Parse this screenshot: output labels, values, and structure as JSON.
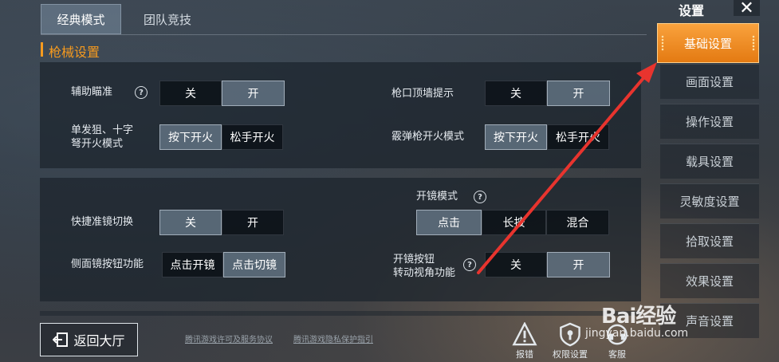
{
  "tabs": [
    {
      "label": "经典模式",
      "active": true
    },
    {
      "label": "团队竞技",
      "active": false
    }
  ],
  "section_title": "枪械设置",
  "panel1": {
    "aim_assist": {
      "label": "辅助瞄准",
      "options": [
        "关",
        "开"
      ],
      "selected": "开"
    },
    "muzzle_hint": {
      "label": "枪口顶墙提示",
      "options": [
        "关",
        "开"
      ],
      "selected": "开"
    },
    "single_fire": {
      "label_line1": "单发狙、十字",
      "label_line2": "弩开火模式",
      "options": [
        "按下开火",
        "松手开火"
      ],
      "selected": "按下开火"
    },
    "shotgun_fire": {
      "label": "霰弹枪开火模式",
      "options": [
        "按下开火",
        "松手开火"
      ],
      "selected": "按下开火"
    }
  },
  "panel2": {
    "quick_scope": {
      "label": "快捷准镜切换",
      "options": [
        "关",
        "开"
      ],
      "selected": "关"
    },
    "scope_mode": {
      "label": "开镜模式",
      "options": [
        "点击",
        "长按",
        "混合"
      ],
      "selected": "点击"
    },
    "side_scope": {
      "label": "侧面镜按钮功能",
      "options": [
        "点击开镜",
        "点击切镜"
      ],
      "selected": "点击切镜"
    },
    "scope_rotate": {
      "label_line1": "开镜按钮",
      "label_line2": "转动视角功能",
      "options": [
        "关",
        "开"
      ],
      "selected": "开"
    }
  },
  "sidebar": {
    "title": "设置",
    "items": [
      {
        "label": "基础设置",
        "active": true
      },
      {
        "label": "画面设置"
      },
      {
        "label": "操作设置"
      },
      {
        "label": "载具设置"
      },
      {
        "label": "灵敏度设置"
      },
      {
        "label": "拾取设置"
      },
      {
        "label": "效果设置"
      },
      {
        "label": "声音设置"
      }
    ]
  },
  "bottom": {
    "back_label": "返回大厅",
    "link1": "腾讯游戏许可及服务协议",
    "link2": "腾讯游戏隐私保护指引",
    "report_label": "报错",
    "permission_label": "权限设置",
    "service_label": "客服"
  },
  "watermark": {
    "text": "Bai经验",
    "sub": "jingyan.baidu.com"
  },
  "colors": {
    "accent": "#f59a1f",
    "active_tab": "#e47a12",
    "arrow": "#e8342e"
  }
}
